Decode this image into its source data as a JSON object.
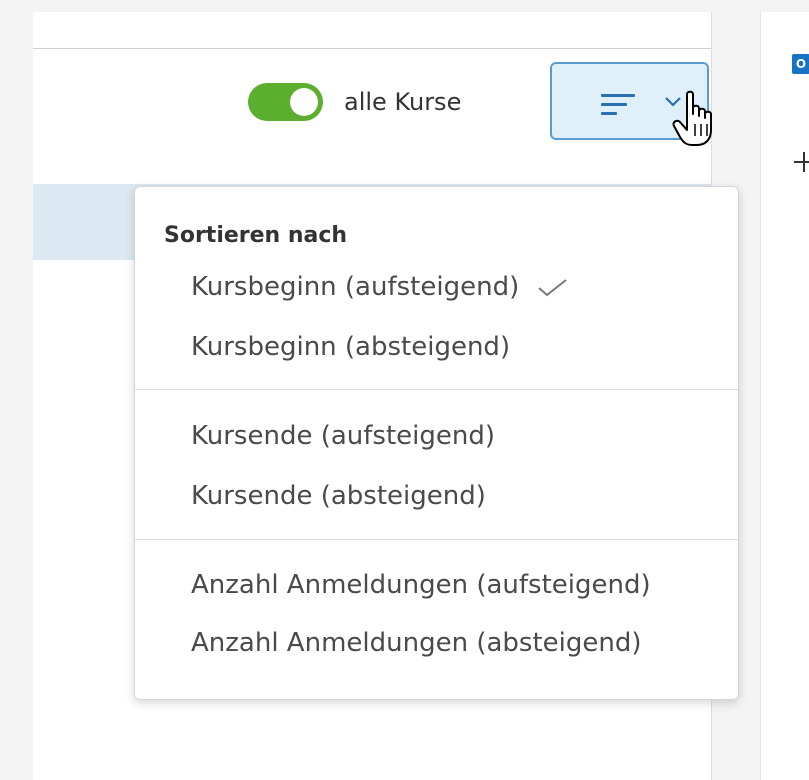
{
  "icons": {
    "outlook": "outlook-icon",
    "plus": "plus-icon",
    "sort": "sort-lines-icon",
    "chevron": "chevron-down-icon",
    "cursor": "hand-pointer-icon",
    "check": "checkmark-icon"
  },
  "colors": {
    "toggle_on": "#5cae2f",
    "sort_button_bg": "#dff0fb",
    "sort_button_border": "#5a9bd2",
    "accent_blue": "#1673c6",
    "selected_row": "#dce9f3"
  },
  "right_panel": {
    "outlook_letter": "O"
  },
  "toolbar": {
    "toggle_label": "alle Kurse",
    "toggle_on": true
  },
  "sort_menu": {
    "heading": "Sortieren nach",
    "groups": [
      [
        {
          "label": "Kursbeginn (aufsteigend)",
          "selected": true
        },
        {
          "label": "Kursbeginn (absteigend)",
          "selected": false
        }
      ],
      [
        {
          "label": "Kursende (aufsteigend)",
          "selected": false
        },
        {
          "label": "Kursende (absteigend)",
          "selected": false
        }
      ],
      [
        {
          "label": "Anzahl Anmeldungen (aufsteigend)",
          "selected": false
        },
        {
          "label": "Anzahl Anmeldungen (absteigend)",
          "selected": false
        }
      ]
    ]
  }
}
